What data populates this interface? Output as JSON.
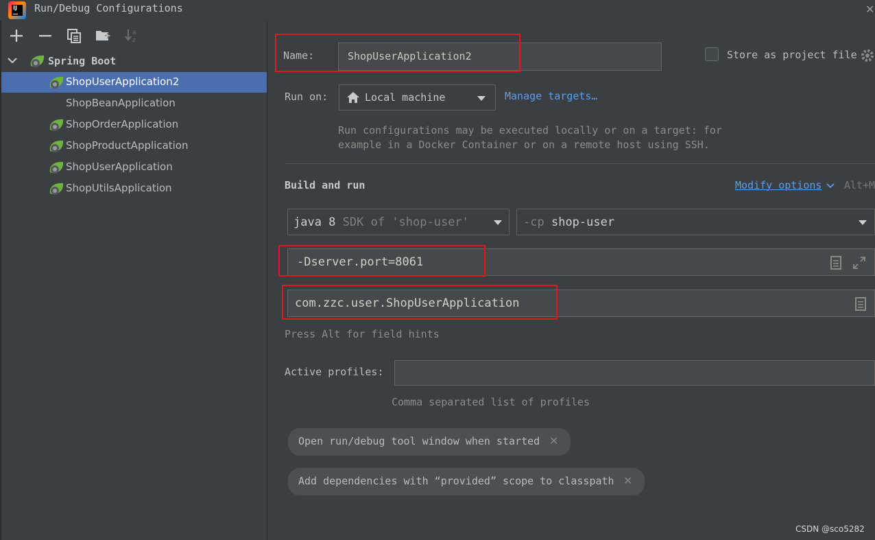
{
  "window": {
    "title": "Run/Debug Configurations"
  },
  "toolbar": {
    "icons": [
      "add-icon",
      "remove-icon",
      "copy-icon",
      "new-folder-icon",
      "sort-icon"
    ]
  },
  "tree": {
    "group_label": "Spring Boot",
    "items": [
      {
        "label": "ShopUserApplication2",
        "selected": true,
        "has_icon": true
      },
      {
        "label": "ShopBeanApplication",
        "selected": false,
        "has_icon": false
      },
      {
        "label": "ShopOrderApplication",
        "selected": false,
        "has_icon": true
      },
      {
        "label": "ShopProductApplication",
        "selected": false,
        "has_icon": true
      },
      {
        "label": "ShopUserApplication",
        "selected": false,
        "has_icon": true
      },
      {
        "label": "ShopUtilsApplication",
        "selected": false,
        "has_icon": true
      }
    ]
  },
  "config": {
    "name_label": "Name:",
    "name_value": "ShopUserApplication2",
    "store_label": "Store as project file",
    "run_on_label": "Run on:",
    "run_on_value": "Local machine",
    "manage_targets": "Manage targets…",
    "run_on_hint_1": "Run configurations may be executed locally or on a target: for",
    "run_on_hint_2": "example in a Docker Container or on a remote host using SSH.",
    "build_and_run": "Build and run",
    "modify_options": "Modify options",
    "modify_shortcut": "Alt+M",
    "jdk_main": "java 8",
    "jdk_hint": "SDK of 'shop-user'",
    "cp_prefix": "-cp",
    "cp_value": "shop-user",
    "vm_options": "-Dserver.port=8061",
    "main_class": "com.zzc.user.ShopUserApplication",
    "field_hints": "Press Alt for field hints",
    "active_profiles_label": "Active profiles:",
    "active_profiles_value": "",
    "active_profiles_hint": "Comma separated list of profiles",
    "chip_1": "Open run/debug tool window when started",
    "chip_2": "Add dependencies with “provided” scope to classpath"
  },
  "watermark": "CSDN @sco5282",
  "colors": {
    "background": "#3c3f41",
    "selection": "#4b6eaf",
    "link": "#589df6",
    "highlight_box": "#e0191c",
    "spring_green": "#6db33f"
  }
}
